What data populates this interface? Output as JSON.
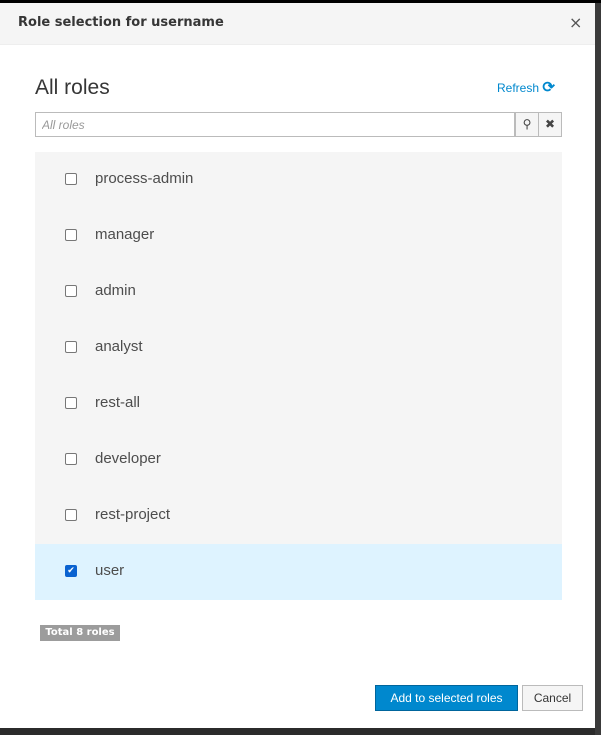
{
  "dialog": {
    "title": "Role selection for username",
    "close_icon": "×"
  },
  "heading": "All roles",
  "refresh": {
    "label": "Refresh",
    "icon": "⟳"
  },
  "search": {
    "placeholder": "All roles",
    "value": "",
    "search_icon": "⚲",
    "clear_icon": "✖"
  },
  "roles": [
    {
      "name": "process-admin",
      "checked": false
    },
    {
      "name": "manager",
      "checked": false
    },
    {
      "name": "admin",
      "checked": false
    },
    {
      "name": "analyst",
      "checked": false
    },
    {
      "name": "rest-all",
      "checked": false
    },
    {
      "name": "developer",
      "checked": false
    },
    {
      "name": "rest-project",
      "checked": false
    },
    {
      "name": "user",
      "checked": true
    }
  ],
  "total_badge": "Total 8 roles",
  "buttons": {
    "add": "Add to selected roles",
    "cancel": "Cancel"
  }
}
